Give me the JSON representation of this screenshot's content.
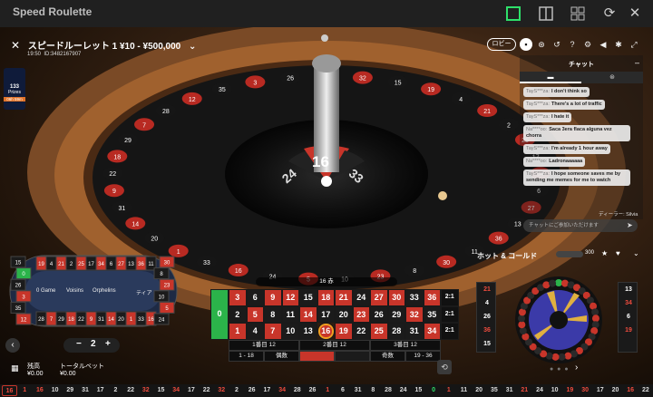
{
  "app_title": "Speed Roulette",
  "window_controls": [
    "fullscreen-icon",
    "split-icon",
    "grid-icon",
    "refresh-icon",
    "close-icon"
  ],
  "header": {
    "table_name": "スピードルーレット 1 ¥10 - ¥500,000",
    "time": "19:50",
    "game_id": "ID:3482167907",
    "promo_count": "133",
    "promo_prizes": "Prizes",
    "promo_time": "06h 59m"
  },
  "top_controls": {
    "lobby_label": "ロビー",
    "icons": [
      "chat-icon",
      "stats-icon",
      "history-icon",
      "help-icon",
      "settings-icon",
      "volume-icon",
      "gear-icon",
      "fullscreen-icon"
    ]
  },
  "chat": {
    "title": "チャット",
    "minimize": "–",
    "messages": [
      {
        "user": "TayS***za:",
        "text": "I don't think so"
      },
      {
        "user": "TayS***za:",
        "text": "There's a lot of traffic"
      },
      {
        "user": "TayS***za:",
        "text": "I hate it"
      },
      {
        "user": "Na****oo:",
        "text": "Saca 3era flaca alguna vez chorra"
      },
      {
        "user": "TayS***za:",
        "text": "I'm already 1 hour away"
      },
      {
        "user": "Na****oo:",
        "text": "Ladronaaaaaa"
      },
      {
        "user": "TayS***za:",
        "text": "I hope someone saves me by sending me memes for me to watch"
      }
    ],
    "input_placeholder": "チャットにご参加いただけます",
    "dealer_label": "ディーラー: Silvia"
  },
  "result": {
    "number": "16",
    "left_neighbor": "24",
    "right_neighbor": "33",
    "strip": "16 赤"
  },
  "racetrack": {
    "top": [
      "19",
      "4",
      "21",
      "2",
      "25",
      "17",
      "34",
      "6",
      "27",
      "13",
      "36",
      "11"
    ],
    "bottom": [
      "28",
      "7",
      "29",
      "18",
      "22",
      "9",
      "31",
      "14",
      "20",
      "1",
      "33",
      "16"
    ],
    "left": [
      "15",
      "0",
      "26",
      "3",
      "35",
      "12"
    ],
    "right": [
      "30",
      "8",
      "23",
      "10",
      "5",
      "24"
    ],
    "sections": [
      "0 Game",
      "Voisins",
      "Orphelins",
      "ティア"
    ]
  },
  "chip": {
    "value": "2",
    "minus": "−",
    "plus": "+"
  },
  "balance": {
    "label": "残高",
    "value": "¥0.00"
  },
  "total_bet": {
    "label": "トータルベット",
    "value": "¥0.00"
  },
  "board": {
    "zero": "0",
    "rows": [
      [
        "3",
        "6",
        "9",
        "12",
        "15",
        "18",
        "21",
        "24",
        "27",
        "30",
        "33",
        "36",
        "2:1"
      ],
      [
        "2",
        "5",
        "8",
        "11",
        "14",
        "17",
        "20",
        "23",
        "26",
        "29",
        "32",
        "35",
        "2:1"
      ],
      [
        "1",
        "4",
        "7",
        "10",
        "13",
        "16",
        "19",
        "22",
        "25",
        "28",
        "31",
        "34",
        "2:1"
      ]
    ],
    "dozens": [
      "1番目 12",
      "2番目 12",
      "3番目 12"
    ],
    "outside": [
      "1 - 18",
      "偶数",
      "",
      "",
      "奇数",
      "19 - 36"
    ]
  },
  "hot_cold": {
    "title": "ホット & コールド",
    "count": "300",
    "hot": [
      "21",
      "4",
      "26",
      "36",
      "15"
    ],
    "cold": [
      "13",
      "34",
      "6",
      "19"
    ]
  },
  "history": [
    "16",
    "1",
    "16",
    "10",
    "29",
    "31",
    "17",
    "2",
    "22",
    "32",
    "15",
    "34",
    "17",
    "22",
    "32",
    "2",
    "26",
    "17",
    "34",
    "28",
    "26",
    "1",
    "6",
    "31",
    "8",
    "28",
    "24",
    "15",
    "0",
    "1",
    "11",
    "20",
    "35",
    "31",
    "21",
    "24",
    "10",
    "19",
    "30",
    "17",
    "20",
    "16",
    "22"
  ],
  "colors": {
    "red": "#c8352a",
    "black": "#1b1b1b",
    "green": "#2bb34a",
    "accent": "#f0a020"
  }
}
